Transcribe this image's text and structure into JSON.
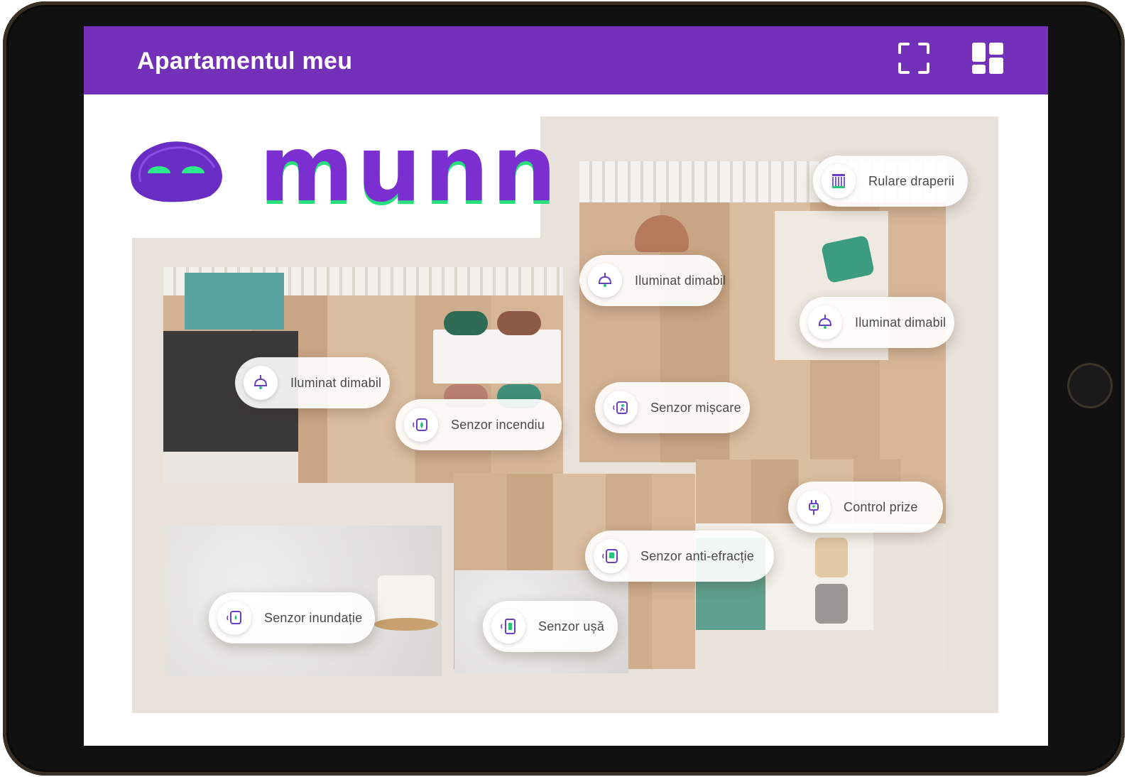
{
  "header": {
    "title": "Apartamentul meu",
    "fullscreen_icon": "fullscreen-icon",
    "dashboard_icon": "dashboard-grid-icon"
  },
  "brand": {
    "name": "munn",
    "mascot_icon": "robot-face-icon"
  },
  "devices": [
    {
      "label": "Rulare draperii",
      "icon": "curtain-icon"
    },
    {
      "label": "Iluminat dimabil",
      "icon": "ceiling-lamp-icon"
    },
    {
      "label": "Iluminat dimabil",
      "icon": "ceiling-lamp-icon"
    },
    {
      "label": "Iluminat dimabil",
      "icon": "ceiling-lamp-icon"
    },
    {
      "label": "Senzor incendiu",
      "icon": "fire-sensor-icon"
    },
    {
      "label": "Senzor mișcare",
      "icon": "motion-sensor-icon"
    },
    {
      "label": "Control prize",
      "icon": "plug-icon"
    },
    {
      "label": "Senzor anti-efracție",
      "icon": "glass-break-sensor-icon"
    },
    {
      "label": "Senzor inundație",
      "icon": "flood-sensor-icon"
    },
    {
      "label": "Senzor ușă",
      "icon": "door-sensor-icon"
    }
  ],
  "colors": {
    "accent": "#7330b8",
    "brand_green": "#27e07d",
    "icon_purple": "#6a3fc0"
  }
}
